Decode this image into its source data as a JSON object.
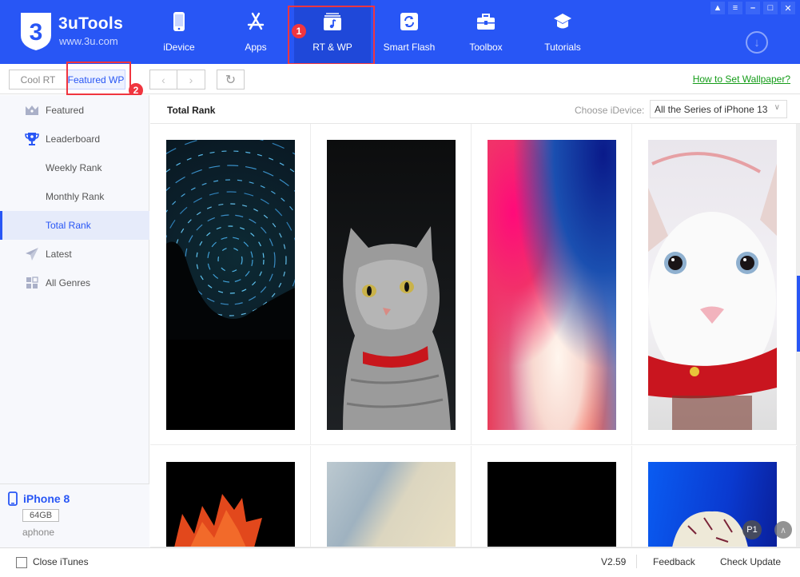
{
  "app": {
    "name": "3uTools",
    "url": "www.3u.com"
  },
  "nav": [
    {
      "label": "iDevice",
      "icon": "phone-icon"
    },
    {
      "label": "Apps",
      "icon": "app-store-icon"
    },
    {
      "label": "RT & WP",
      "icon": "music-note-icon",
      "active": true
    },
    {
      "label": "Smart Flash",
      "icon": "refresh-icon"
    },
    {
      "label": "Toolbox",
      "icon": "toolbox-icon"
    },
    {
      "label": "Tutorials",
      "icon": "graduation-cap-icon"
    }
  ],
  "window_controls": [
    "skin",
    "menu",
    "minimize",
    "maximize",
    "close"
  ],
  "annotations": {
    "badge1": "1",
    "badge2": "2"
  },
  "toolbar": {
    "cool_rt": "Cool RT",
    "featured_wp": "Featured WP",
    "back": "‹",
    "forward": "›",
    "refresh": "↻",
    "how_to": "How to Set Wallpaper?"
  },
  "sidebar": {
    "items": [
      {
        "label": "Featured",
        "icon": "crown-icon"
      },
      {
        "label": "Leaderboard",
        "icon": "trophy-icon"
      },
      {
        "label": "Weekly Rank"
      },
      {
        "label": "Monthly Rank"
      },
      {
        "label": "Total Rank",
        "active": true
      },
      {
        "label": "Latest",
        "icon": "paper-plane-icon"
      },
      {
        "label": "All Genres",
        "icon": "grid-icon"
      }
    ]
  },
  "device": {
    "name": "iPhone 8",
    "capacity": "64GB",
    "user": "aphone"
  },
  "main": {
    "title": "Total Rank",
    "choose_label": "Choose iDevice:",
    "choose_value": "All the Series of iPhone 13",
    "wallpapers": [
      {
        "name": "Star trails"
      },
      {
        "name": "Grey cat with red collar"
      },
      {
        "name": "iPhone X gradient"
      },
      {
        "name": "White kitten"
      },
      {
        "name": "Betta fish"
      },
      {
        "name": "Sky gradient"
      },
      {
        "name": "Black"
      },
      {
        "name": "Shell on blue"
      }
    ],
    "page_indicator": "P1"
  },
  "footer": {
    "close_itunes": "Close iTunes",
    "version": "V2.59",
    "feedback": "Feedback",
    "check_update": "Check Update"
  }
}
